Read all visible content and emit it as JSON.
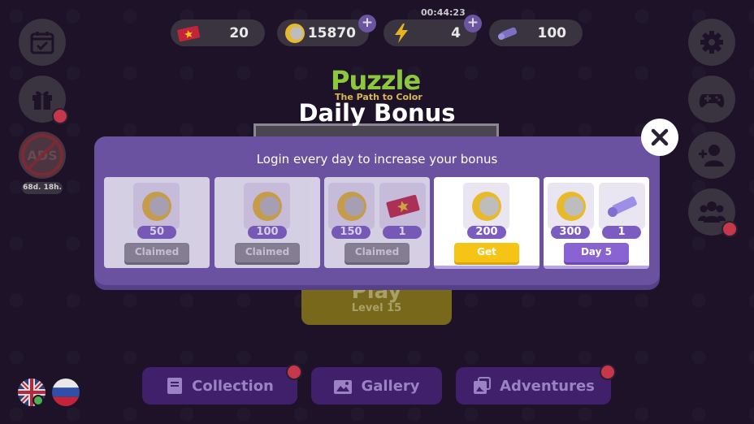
{
  "topbar": {
    "tickets": "20",
    "coins": "15870",
    "energy": "4",
    "energy_timer": "00:44:23",
    "tubes": "100",
    "plus_label": "+"
  },
  "side": {
    "ads_timer": "68d. 18h."
  },
  "background": {
    "logo_title": "Puzzle",
    "logo_subtitle": "The Path to Color",
    "play_label": "Play",
    "level_label": "Level 15"
  },
  "modal": {
    "title": "Daily Bonus",
    "subtitle": "Login every day to increase your bonus",
    "days": [
      {
        "coins": "50",
        "action": "Claimed"
      },
      {
        "coins": "100",
        "action": "Claimed"
      },
      {
        "coins": "150",
        "extra": "1",
        "action": "Claimed"
      },
      {
        "coins": "200",
        "action": "Get"
      },
      {
        "coins": "300",
        "extra": "1",
        "action": "Day 5"
      }
    ]
  },
  "nav": {
    "collection": "Collection",
    "gallery": "Gallery",
    "adventures": "Adventures"
  },
  "colors": {
    "modal_bg": "#6b52a0",
    "get_button": "#f6c417",
    "badge": "#7b5cc0",
    "notification": "#c7374a"
  }
}
